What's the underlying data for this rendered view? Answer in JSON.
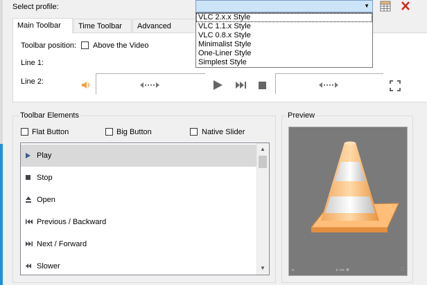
{
  "profile": {
    "label": "Select profile:",
    "options": [
      "VLC 2.x.x Style",
      "VLC 1.1.x Style",
      "VLC 0.8.x Style",
      "Minimalist Style",
      "One-Liner Style",
      "Simplest Style"
    ]
  },
  "tabs": [
    "Main Toolbar",
    "Time Toolbar",
    "Advanced Widge"
  ],
  "main": {
    "toolbar_position_label": "Toolbar position:",
    "above_video_label": "Above the Video",
    "line1_label": "Line 1:",
    "line2_label": "Line 2:"
  },
  "elements": {
    "title": "Toolbar Elements",
    "flat_button": "Flat Button",
    "big_button": "Big Button",
    "native_slider": "Native Slider",
    "items": [
      {
        "icon": "play-icon",
        "label": "Play"
      },
      {
        "icon": "stop-icon",
        "label": "Stop"
      },
      {
        "icon": "eject-icon",
        "label": "Open"
      },
      {
        "icon": "previous-icon",
        "label": "Previous / Backward"
      },
      {
        "icon": "next-icon",
        "label": "Next / Forward"
      },
      {
        "icon": "slower-icon",
        "label": "Slower"
      }
    ]
  },
  "preview": {
    "title": "Preview"
  }
}
